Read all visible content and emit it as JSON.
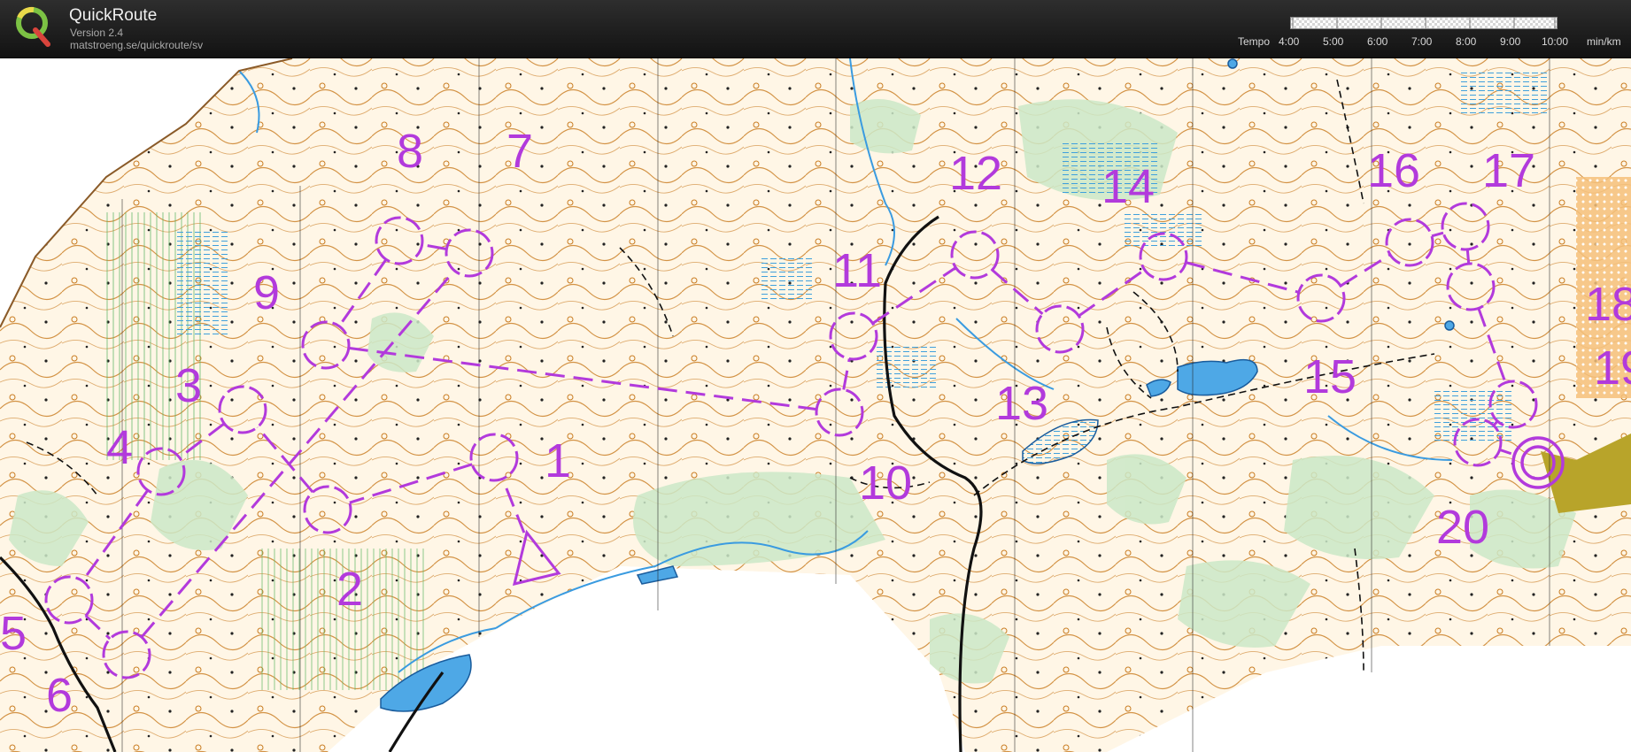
{
  "header": {
    "app_title": "QuickRoute",
    "version": "Version 2.4",
    "url": "matstroeng.se/quickroute/sv"
  },
  "tempo": {
    "label": "Tempo",
    "ticks": [
      "4:00",
      "5:00",
      "6:00",
      "7:00",
      "8:00",
      "9:00",
      "10:00"
    ],
    "unit": "min/km"
  },
  "map": {
    "course_color": "#b23adc",
    "controls": [
      {
        "id": "start",
        "label": ""
      },
      {
        "id": "c1",
        "label": "1"
      },
      {
        "id": "c2",
        "label": "2"
      },
      {
        "id": "c3",
        "label": "3"
      },
      {
        "id": "c4",
        "label": "4"
      },
      {
        "id": "c5",
        "label": "5"
      },
      {
        "id": "c6",
        "label": "6"
      },
      {
        "id": "c7",
        "label": "7"
      },
      {
        "id": "c8",
        "label": "8"
      },
      {
        "id": "c9",
        "label": "9"
      },
      {
        "id": "c10",
        "label": "10"
      },
      {
        "id": "c11",
        "label": "11"
      },
      {
        "id": "c12",
        "label": "12"
      },
      {
        "id": "c13",
        "label": "13"
      },
      {
        "id": "c14",
        "label": "14"
      },
      {
        "id": "c15",
        "label": "15"
      },
      {
        "id": "c16",
        "label": "16"
      },
      {
        "id": "c17",
        "label": "17"
      },
      {
        "id": "c18",
        "label": "18"
      },
      {
        "id": "c19",
        "label": "19"
      },
      {
        "id": "c20",
        "label": "20"
      },
      {
        "id": "finish",
        "label": ""
      }
    ]
  }
}
